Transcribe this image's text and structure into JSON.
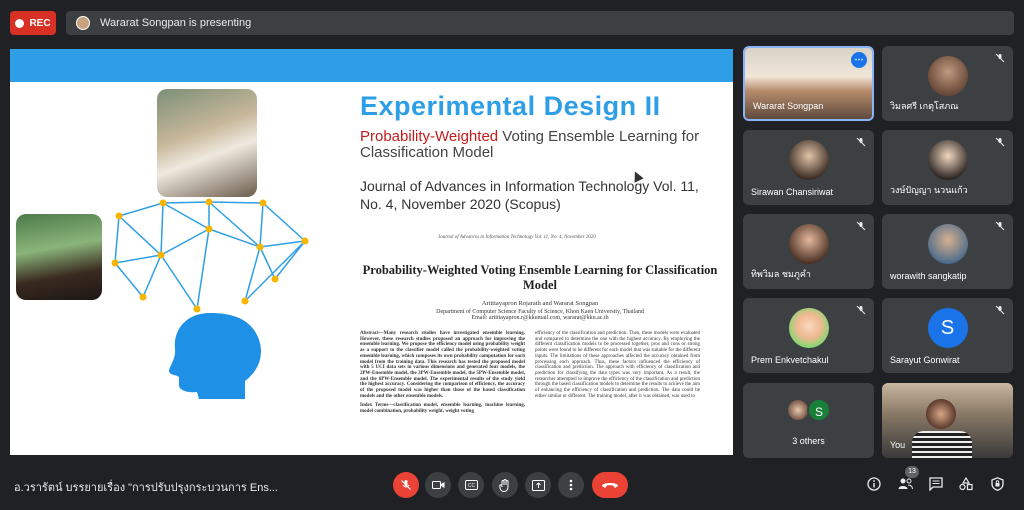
{
  "recording": {
    "label": "REC"
  },
  "presenter_bar": {
    "text": "Wararat Songpan is presenting"
  },
  "slide": {
    "title": "Experimental Design II",
    "subtitle_highlight": "Probability-Weighted",
    "subtitle_rest": " Voting Ensemble Learning for Classification Model",
    "journal": "Journal of Advances in Information Technology Vol. 11, No. 4, November 2020 (Scopus)",
    "paper_header": "Journal of Advances in Information Technology Vol. 11, No. 4, November 2020",
    "paper_title": "Probability-Weighted Voting Ensemble Learning for Classification Model",
    "authors": "Artittayapron Rojarath and Wararat Songpan",
    "affiliation": "Department of Computer Science Faculty of Science, Khon Kaen University, Thailand",
    "email": "Email: artittayapron.r@kkumail.com, wararat@kku.ac.th",
    "abstract_left": "Abstract—Many research studies have investigated ensemble learning. However, these research studies proposed an approach for improving the ensemble learning. We propose the efficiency model using probability weight as a support to the classifier model called the probability-weighted voting ensemble learning, which composes its own probability computation for each model from the training data. This research has tested the proposed model with 5 UCI data sets in various dimensions and generated four models, the 2PW-Ensemble model, the 3PW-Ensemble model, the 5PW-Ensemble model, and the 6PW-Ensemble model. The experimental results of the study yield the highest accuracy. Considering the comparison of efficiency, the accuracy of the proposed model was higher than those of the based classification models and the other ensemble models.",
    "index_terms": "Index Terms—classification model, ensemble learning, machine learning, model combination, probability weight, weight voting",
    "abstract_right": "efficiency of the classification and prediction. Then, these models were evaluated and compared to determine the one with the highest accuracy. By employing the different classification models to be processed together, pros and cons or strong points were found to be different for each model that was suitable for the different inputs. The limitations of these approaches affected the accuracy obtained from processing each approach. Thus, these factors influenced the efficiency of classification and prediction. The approach with efficiency of classification and prediction for classifying the data types was very important. As a result, the researcher attempted to improve the efficiency of the classification and prediction through the based classification models to determine the results to achieve the aim of enhancing the efficiency of classification and prediction. The data could be either similar or different. The training model, after it was obtained, was used to"
  },
  "participants": [
    {
      "name": "Wararat Songpan",
      "active": true
    },
    {
      "name": "วิมลศรี เกตุโสภณ"
    },
    {
      "name": "Sirawan Chansiriwat"
    },
    {
      "name": "วงษ์ปัญญา นวนแก้ว"
    },
    {
      "name": "ทิพวิมล ชมภูคำ"
    },
    {
      "name": "worawith sangkatip"
    },
    {
      "name": "Prem Enkvetchakul"
    },
    {
      "name": "Sarayut Gonwirat",
      "initial": "S"
    },
    {
      "name": "3 others",
      "initial": "S"
    },
    {
      "name": "You"
    }
  ],
  "bottom_bar": {
    "meeting_title": "อ.วรารัตน์ บรรยายเรื่อง \"การปรับปรุงกระบวนการ Ens...",
    "people_count": "13"
  },
  "colors": {
    "accent": "#2e9fe6",
    "hangup": "#ea4335",
    "active_border": "#8ab4f8"
  }
}
